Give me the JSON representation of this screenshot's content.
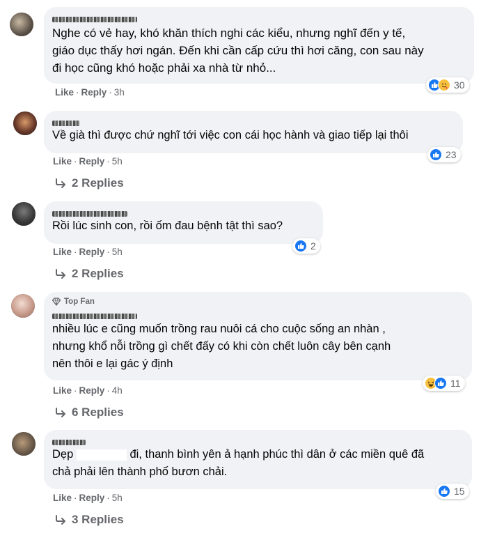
{
  "comments": [
    {
      "text": "Nghe có vẻ hay, khó khăn thích nghi các kiểu, nhưng nghĩ đến y tế,\ngiáo dục thấy hơi ngán. Đến khi cần cấp cứu thì hơi căng, con sau này\nđi học cũng khó hoặc phải xa nhà từ nhỏ...",
      "like": "Like",
      "reply": "Reply",
      "time": "3h",
      "reactions": "30"
    },
    {
      "text": "Về già thì được chứ nghĩ tới việc con cái học hành và giao tiếp lại thôi",
      "like": "Like",
      "reply": "Reply",
      "time": "5h",
      "reactions": "23",
      "replies": "2 Replies"
    },
    {
      "text": "Rồi lúc sinh con, rồi ốm đau bệnh tật thì sao?",
      "like": "Like",
      "reply": "Reply",
      "time": "5h",
      "reactions": "2",
      "replies": "2 Replies"
    },
    {
      "badge": "Top Fan",
      "text": "nhiều lúc e cũng muốn trồng rau nuôi cá cho cuộc sống an nhàn ,\nnhưng khổ nỗi trồng gì chết đấy có khi còn chết luôn cây bên cạnh\nnên thôi e lại gác ý định",
      "like": "Like",
      "reply": "Reply",
      "time": "4h",
      "reactions": "11",
      "replies": "6 Replies"
    },
    {
      "text_start": "Dẹp",
      "text_end": "đi, thanh bình yên ả hạnh phúc thì dân ở các miền quê đã\nchả phải lên thành phố bươn chải.",
      "like": "Like",
      "reply": "Reply",
      "time": "5h",
      "reactions": "15",
      "replies": "3 Replies"
    }
  ],
  "colors": {
    "like_blue": "#1877f2",
    "bubble": "#f0f2f5",
    "meta": "#65676b"
  },
  "icons": [
    "like-icon",
    "haha-icon",
    "care-icon",
    "reply-arrow-icon",
    "diamond-icon"
  ]
}
